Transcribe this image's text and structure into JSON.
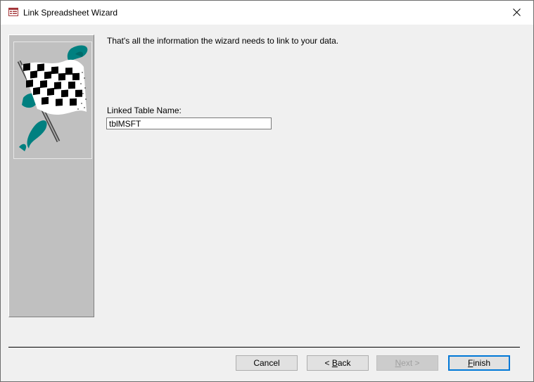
{
  "window": {
    "title": "Link Spreadsheet Wizard",
    "app_icon": "form-icon",
    "close_icon": "close-icon"
  },
  "side_panel": {
    "image": "checkered-flag-icon"
  },
  "content": {
    "intro": "That's all the information the wizard needs to link to your data.",
    "table_name_label": "Linked Table Name:",
    "table_name_value": "tblMSFT"
  },
  "buttons": {
    "cancel": "Cancel",
    "back_prefix": "< ",
    "back_key": "B",
    "back_rest": "ack",
    "next_key": "N",
    "next_rest": "ext >",
    "finish_key": "F",
    "finish_rest": "inish"
  },
  "colors": {
    "accent": "#0078d7",
    "panel": "#c0c0c0",
    "teal": "#008080"
  }
}
